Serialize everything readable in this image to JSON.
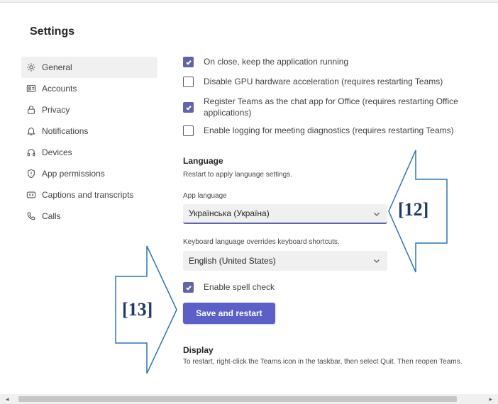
{
  "settings": {
    "title": "Settings"
  },
  "sidebar": {
    "items": [
      {
        "label": "General",
        "icon": "gear-icon"
      },
      {
        "label": "Accounts",
        "icon": "id-card-icon"
      },
      {
        "label": "Privacy",
        "icon": "lock-icon"
      },
      {
        "label": "Notifications",
        "icon": "bell-icon"
      },
      {
        "label": "Devices",
        "icon": "headset-icon"
      },
      {
        "label": "App permissions",
        "icon": "shield-icon"
      },
      {
        "label": "Captions and transcripts",
        "icon": "captions-icon"
      },
      {
        "label": "Calls",
        "icon": "phone-icon"
      }
    ]
  },
  "application": {
    "options": [
      {
        "label": "On close, keep the application running",
        "checked": true
      },
      {
        "label": "Disable GPU hardware acceleration (requires restarting Teams)",
        "checked": false
      },
      {
        "label": "Register Teams as the chat app for Office (requires restarting Office applications)",
        "checked": true
      },
      {
        "label": "Enable logging for meeting diagnostics (requires restarting Teams)",
        "checked": false
      }
    ]
  },
  "language": {
    "title": "Language",
    "subtitle": "Restart to apply language settings.",
    "app_language_label": "App language",
    "app_language_value": "Українська (Україна)",
    "keyboard_label": "Keyboard language overrides keyboard shortcuts.",
    "keyboard_value": "English (United States)",
    "spell_check_label": "Enable spell check",
    "spell_check_checked": true,
    "save_button": "Save and restart"
  },
  "display": {
    "title": "Display",
    "description": "To restart, right-click the Teams icon in the taskbar, then select Quit. Then reopen Teams."
  },
  "callouts": {
    "a": "[12]",
    "b": "[13]"
  },
  "colors": {
    "accent": "#6264a7",
    "button": "#5b5fc7",
    "callout": "#2e75b6"
  }
}
